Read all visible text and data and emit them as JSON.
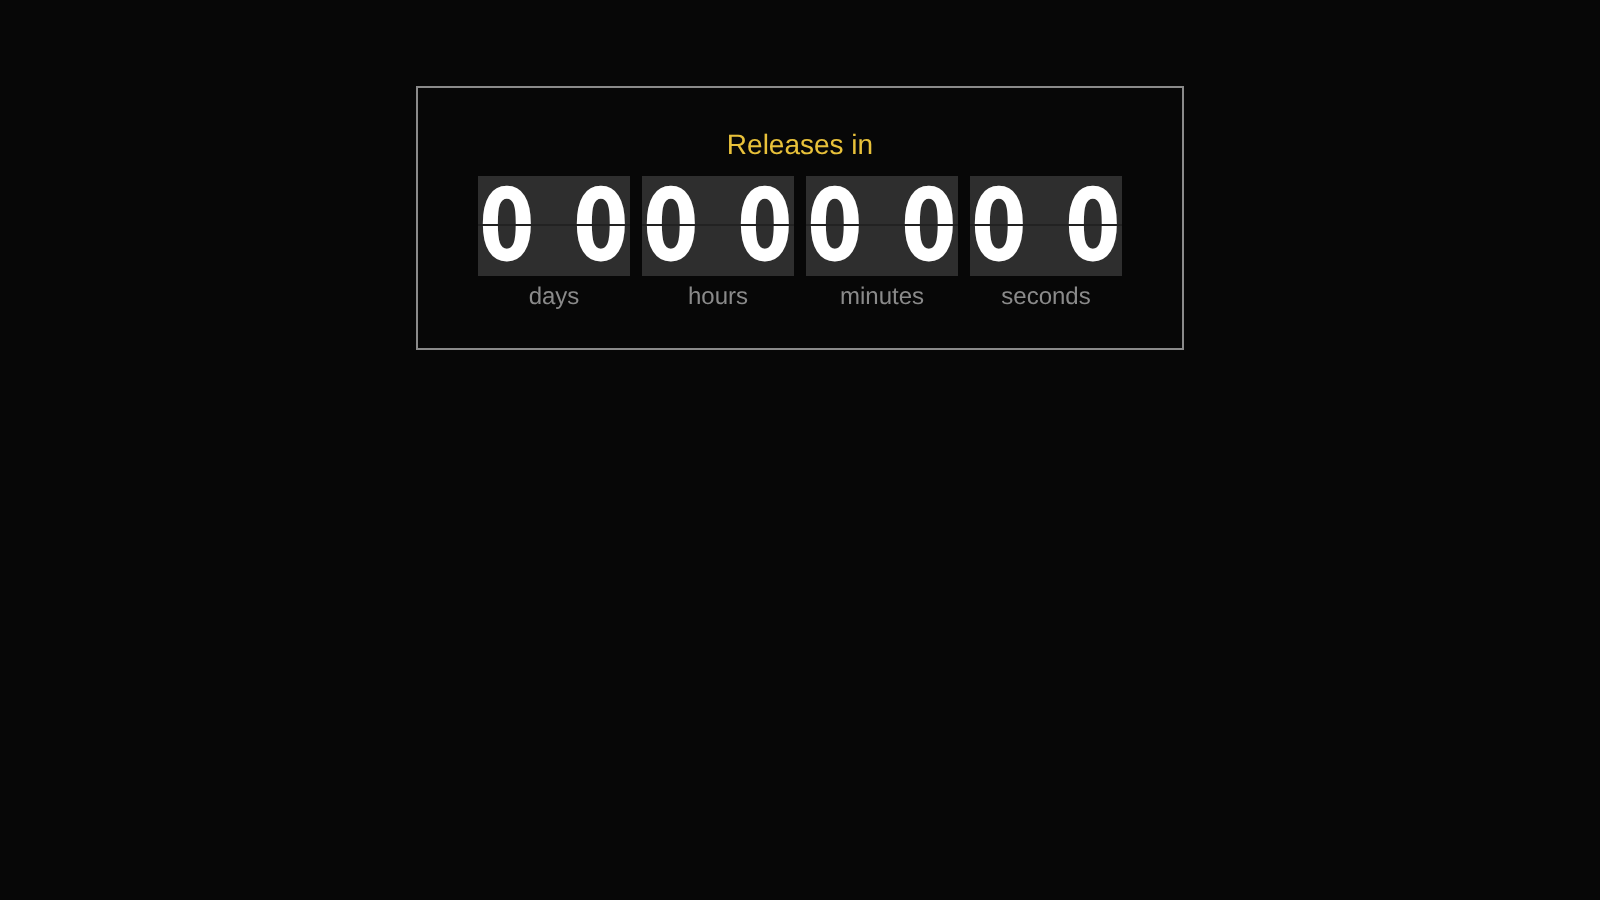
{
  "title": "Releases in",
  "units": [
    {
      "digits": [
        "0",
        "0"
      ],
      "label": "days"
    },
    {
      "digits": [
        "0",
        "0"
      ],
      "label": "hours"
    },
    {
      "digits": [
        "0",
        "0"
      ],
      "label": "minutes"
    },
    {
      "digits": [
        "0",
        "0"
      ],
      "label": "seconds"
    }
  ]
}
